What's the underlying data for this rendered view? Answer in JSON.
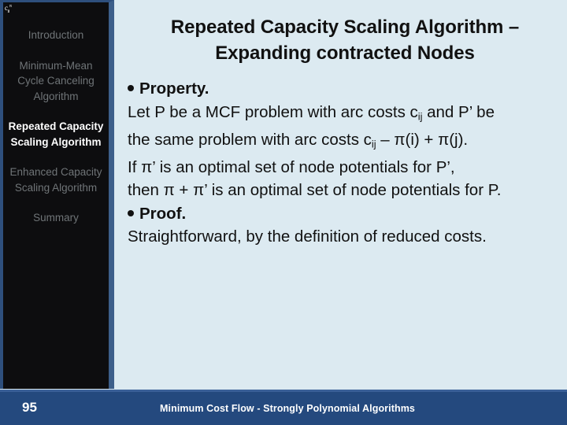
{
  "slide": {
    "corner_mark": "c",
    "corner_mark_sub": "ij",
    "corner_mark_sup": "π",
    "title_line_1": "Repeated Capacity Scaling Algorithm –",
    "title_line_2": "Expanding contracted Nodes",
    "background_color": "#dceaf1"
  },
  "sidebar": {
    "background_color": "#0d0d0f",
    "accent_color": "#3d5f8a",
    "active_color": "#ffffff",
    "inactive_color": "#6f7477",
    "items": [
      {
        "label": "Introduction",
        "active": false
      },
      {
        "label": "Minimum-Mean Cycle Canceling Algorithm",
        "active": false
      },
      {
        "label": "Repeated Capacity Scaling Algorithm",
        "active": true
      },
      {
        "label": "Enhanced Capacity Scaling Algorithm",
        "active": false
      },
      {
        "label": "Summary",
        "active": false
      }
    ]
  },
  "content": {
    "property_heading": "Property.",
    "property_lines": [
      {
        "pre": "Let P be a MCF problem with arc costs c",
        "sub": "ij",
        "post": " and P’ be"
      },
      {
        "pre": "the same problem with arc costs c",
        "sub": "ij",
        "post": " – π(i) + π(j)."
      },
      {
        "pre": "If π’ is an optimal set of node potentials for P’,",
        "sub": "",
        "post": ""
      },
      {
        "pre": "then π + π’ is an optimal set of node potentials for P.",
        "sub": "",
        "post": ""
      }
    ],
    "proof_heading": "Proof.",
    "proof_lines": [
      {
        "pre": "Straightforward, by the definition of reduced costs.",
        "sub": "",
        "post": ""
      }
    ]
  },
  "footer": {
    "page_number": "95",
    "title": "Minimum Cost Flow - Strongly Polynomial Algorithms",
    "background_color": "#24497e"
  }
}
